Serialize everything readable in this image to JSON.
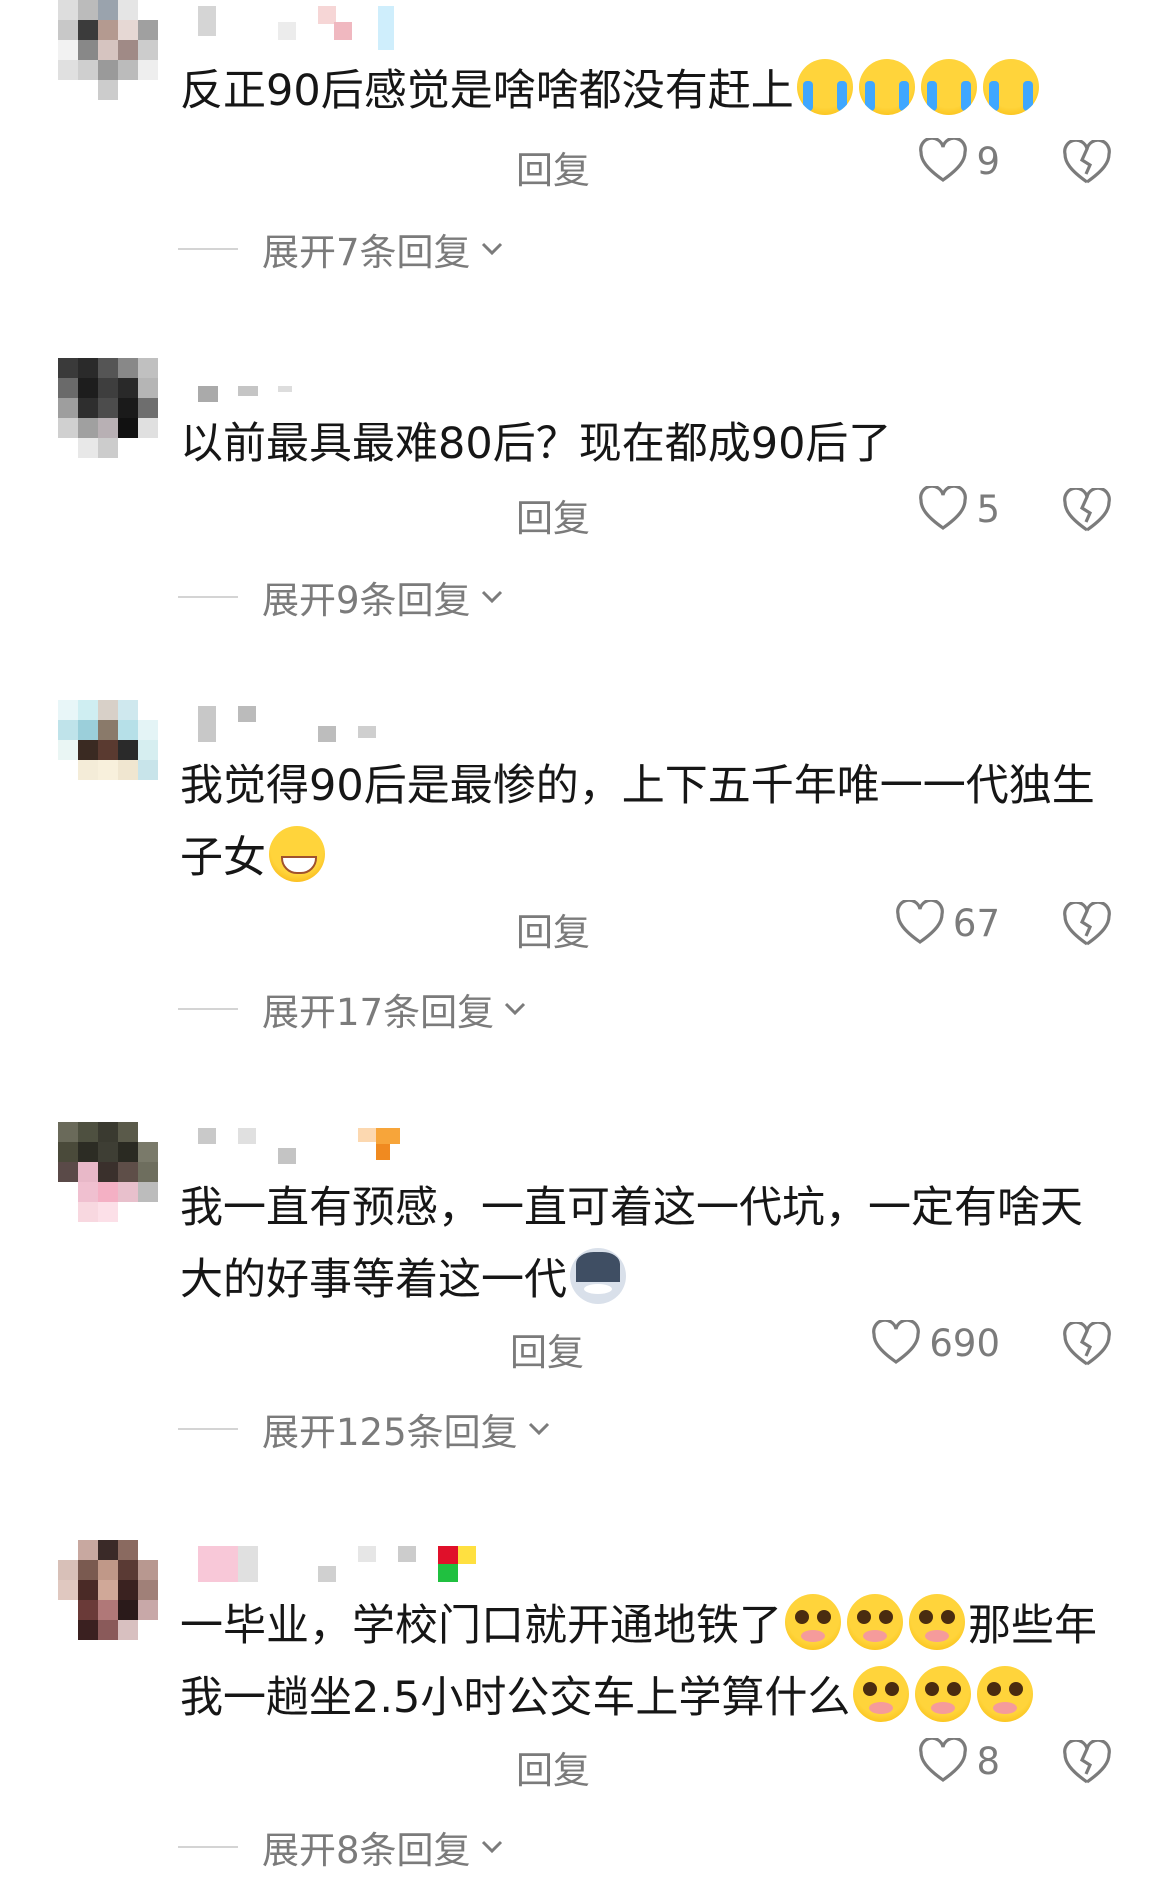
{
  "comments": [
    {
      "text_parts": [
        "反正90后感觉是啥啥都没有赶上"
      ],
      "emojis": [
        "loudly-crying-face",
        "loudly-crying-face",
        "loudly-crying-face",
        "loudly-crying-face"
      ],
      "reply_label": "回复",
      "likes": "9",
      "expand_label": "展开7条回复"
    },
    {
      "text_parts": [
        "以前最具最难80后？现在都成90后了"
      ],
      "emojis": [],
      "reply_label": "回复",
      "likes": "5",
      "expand_label": "展开9条回复"
    },
    {
      "text_parts": [
        "我觉得90后是最惨的，上下五千年唯一一代独生子女"
      ],
      "emojis": [
        "grinning-face"
      ],
      "reply_label": "回复",
      "likes": "67",
      "expand_label": "展开17条回复"
    },
    {
      "text_parts": [
        "我一直有预感，一直可着这一代坑，一定有啥天大的好事等着这一代"
      ],
      "emojis": [
        "husky-dog-face"
      ],
      "reply_label": "回复",
      "likes": "690",
      "expand_label": "展开125条回复"
    },
    {
      "text_parts": [
        "一毕业，学校门口就开通地铁了",
        "那些年我一趟坐2.5小时公交车上学算什么"
      ],
      "emojis": [
        "pleading-face",
        "pleading-face",
        "pleading-face",
        "pleading-face",
        "pleading-face",
        "pleading-face"
      ],
      "reply_label": "回复",
      "likes": "8",
      "expand_label": "展开8条回复"
    }
  ]
}
